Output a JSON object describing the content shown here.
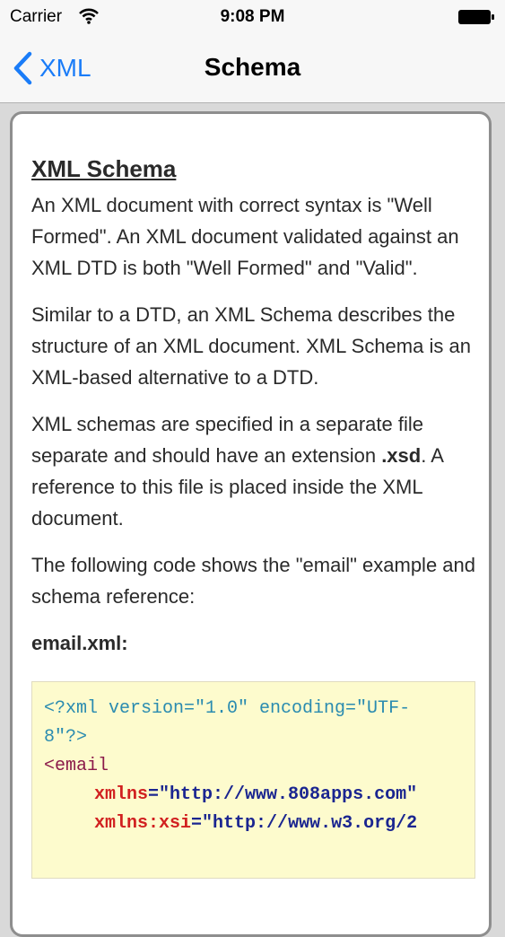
{
  "status": {
    "carrier": "Carrier",
    "time": "9:08 PM"
  },
  "nav": {
    "back_label": "XML",
    "title": "Schema"
  },
  "article": {
    "heading": "XML Schema",
    "p1": "An XML document with correct syntax is \"Well Formed\". An XML document validated against an XML DTD is both \"Well Formed\" and \"Valid\".",
    "p2": "Similar to a DTD, an XML Schema describes the structure of an XML document. XML Schema is an XML-based alternative to a DTD.",
    "p3_before": "XML schemas are specified in a separate file separate and should have an extension ",
    "p3_ext": ".xsd",
    "p3_after": ". A reference to this file is placed inside the XML document.",
    "p4": "The following code shows the \"email\" example and schema reference:",
    "filename": "email.xml:"
  },
  "code": {
    "line1": "<?xml version=\"1.0\" encoding=\"UTF-",
    "line2": "8\"?>",
    "line3": "<email",
    "attr1_name": "xmlns",
    "attr1_value": "\"http://www.808apps.com\"",
    "attr2_name": "xmlns:xsi",
    "attr2_value": "\"http://www.w3.org/2"
  },
  "colors": {
    "accent": "#1a7cf8",
    "code_background": "#fdfbcd"
  },
  "icons": {
    "back": "chevron-left-icon",
    "wifi": "wifi-icon",
    "battery": "battery-icon"
  }
}
